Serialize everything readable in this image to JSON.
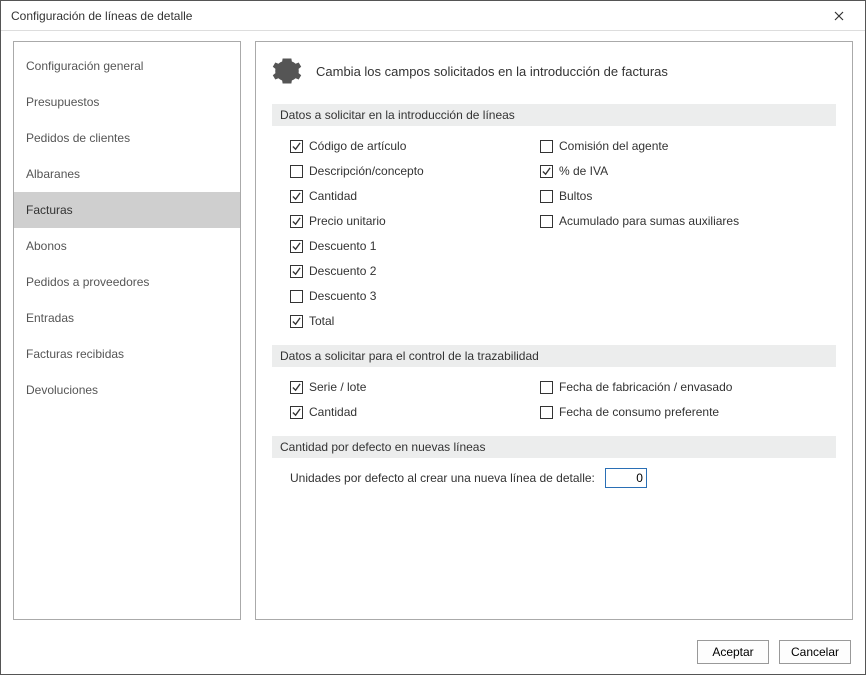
{
  "window": {
    "title": "Configuración de líneas de detalle"
  },
  "sidebar": {
    "items": [
      {
        "label": "Configuración general"
      },
      {
        "label": "Presupuestos"
      },
      {
        "label": "Pedidos de clientes"
      },
      {
        "label": "Albaranes"
      },
      {
        "label": "Facturas"
      },
      {
        "label": "Abonos"
      },
      {
        "label": "Pedidos a proveedores"
      },
      {
        "label": "Entradas"
      },
      {
        "label": "Facturas recibidas"
      },
      {
        "label": "Devoluciones"
      }
    ],
    "selectedIndex": 4
  },
  "content": {
    "header": "Cambia los campos solicitados en la introducción de facturas",
    "section1": {
      "title": "Datos a solicitar en la introducción de líneas",
      "left": [
        {
          "label": "Código de artículo",
          "checked": true
        },
        {
          "label": "Descripción/concepto",
          "checked": false
        },
        {
          "label": "Cantidad",
          "checked": true
        },
        {
          "label": "Precio unitario",
          "checked": true
        },
        {
          "label": "Descuento 1",
          "checked": true
        },
        {
          "label": "Descuento 2",
          "checked": true
        },
        {
          "label": "Descuento 3",
          "checked": false
        },
        {
          "label": "Total",
          "checked": true
        }
      ],
      "right": [
        {
          "label": "Comisión del agente",
          "checked": false
        },
        {
          "label": "% de IVA",
          "checked": true
        },
        {
          "label": "Bultos",
          "checked": false
        },
        {
          "label": "Acumulado para sumas auxiliares",
          "checked": false
        }
      ]
    },
    "section2": {
      "title": "Datos a solicitar para el control de la trazabilidad",
      "left": [
        {
          "label": "Serie / lote",
          "checked": true
        },
        {
          "label": "Cantidad",
          "checked": true
        }
      ],
      "right": [
        {
          "label": "Fecha de fabricación / envasado",
          "checked": false
        },
        {
          "label": "Fecha de consumo preferente",
          "checked": false
        }
      ]
    },
    "section3": {
      "title": "Cantidad por defecto en nuevas líneas",
      "label": "Unidades por defecto al crear una nueva línea de detalle:",
      "value": "0"
    }
  },
  "footer": {
    "accept": "Aceptar",
    "cancel": "Cancelar"
  }
}
